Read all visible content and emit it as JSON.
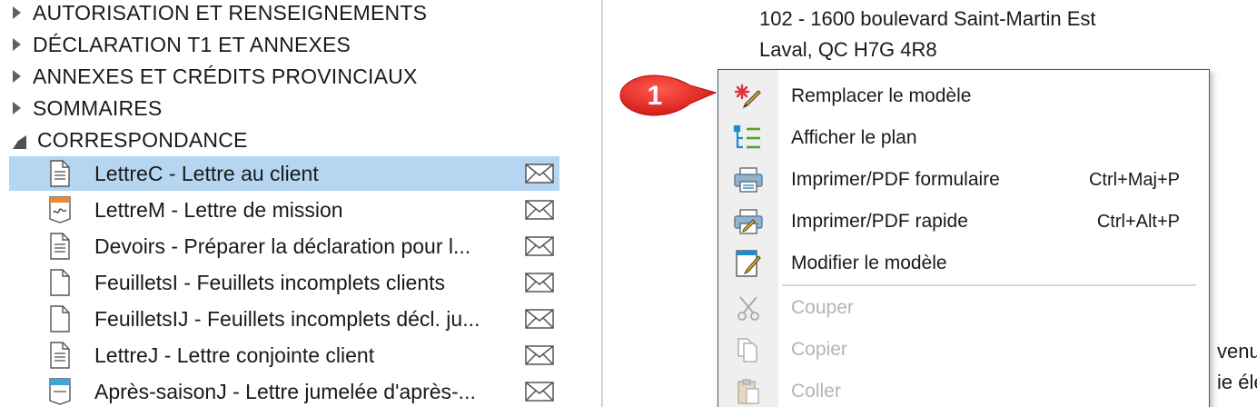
{
  "tree": {
    "sections": [
      {
        "label": "AUTORISATION ET RENSEIGNEMENTS",
        "expanded": false
      },
      {
        "label": "DÉCLARATION T1 ET ANNEXES",
        "expanded": false
      },
      {
        "label": "ANNEXES ET CRÉDITS PROVINCIAUX",
        "expanded": false
      },
      {
        "label": "SOMMAIRES",
        "expanded": false
      },
      {
        "label": "CORRESPONDANCE",
        "expanded": true
      }
    ],
    "documents": [
      {
        "label": "LettreC - Lettre au client",
        "icon": "document-lines-icon",
        "selected": true
      },
      {
        "label": "LettreM - Lettre de mission",
        "icon": "signature-document-icon",
        "selected": false
      },
      {
        "label": "Devoirs - Préparer la déclaration pour l...",
        "icon": "document-lines-icon",
        "selected": false
      },
      {
        "label": "FeuilletsI - Feuillets incomplets clients",
        "icon": "blank-document-icon",
        "selected": false
      },
      {
        "label": "FeuilletsIJ - Feuillets incomplets décl. ju...",
        "icon": "blank-document-icon",
        "selected": false
      },
      {
        "label": "LettreJ - Lettre conjointe client",
        "icon": "document-lines-icon",
        "selected": false
      },
      {
        "label": "Après-saisonJ - Lettre jumelée d'après-...",
        "icon": "blue-header-document-icon",
        "selected": false
      }
    ]
  },
  "preview": {
    "address_line1": "102 - 1600 boulevard Saint-Martin Est",
    "address_line2": "Laval, QC  H7G 4R8",
    "fragment1": "venu",
    "fragment2": "ie éle"
  },
  "callout": {
    "number": "1",
    "color": "#e8231f"
  },
  "context_menu": {
    "items": [
      {
        "label": "Remplacer le modèle",
        "shortcut": "",
        "icon": "replace-template-icon",
        "disabled": false
      },
      {
        "label": "Afficher le plan",
        "shortcut": "",
        "icon": "outline-tree-icon",
        "disabled": false
      },
      {
        "label": "Imprimer/PDF formulaire",
        "shortcut": "Ctrl+Maj+P",
        "icon": "printer-icon",
        "disabled": false
      },
      {
        "label": "Imprimer/PDF rapide",
        "shortcut": "Ctrl+Alt+P",
        "icon": "quick-print-icon",
        "disabled": false
      },
      {
        "label": "Modifier le modèle",
        "shortcut": "",
        "icon": "edit-template-icon",
        "disabled": false
      },
      {
        "label": "Couper",
        "shortcut": "",
        "icon": "scissors-icon",
        "disabled": true
      },
      {
        "label": "Copier",
        "shortcut": "",
        "icon": "copy-icon",
        "disabled": true
      },
      {
        "label": "Coller",
        "shortcut": "",
        "icon": "paste-icon",
        "disabled": true
      }
    ]
  },
  "colors": {
    "selection": "#b5d5f1",
    "menu_border": "#4a5a70",
    "callout_red": "#e8231f"
  }
}
